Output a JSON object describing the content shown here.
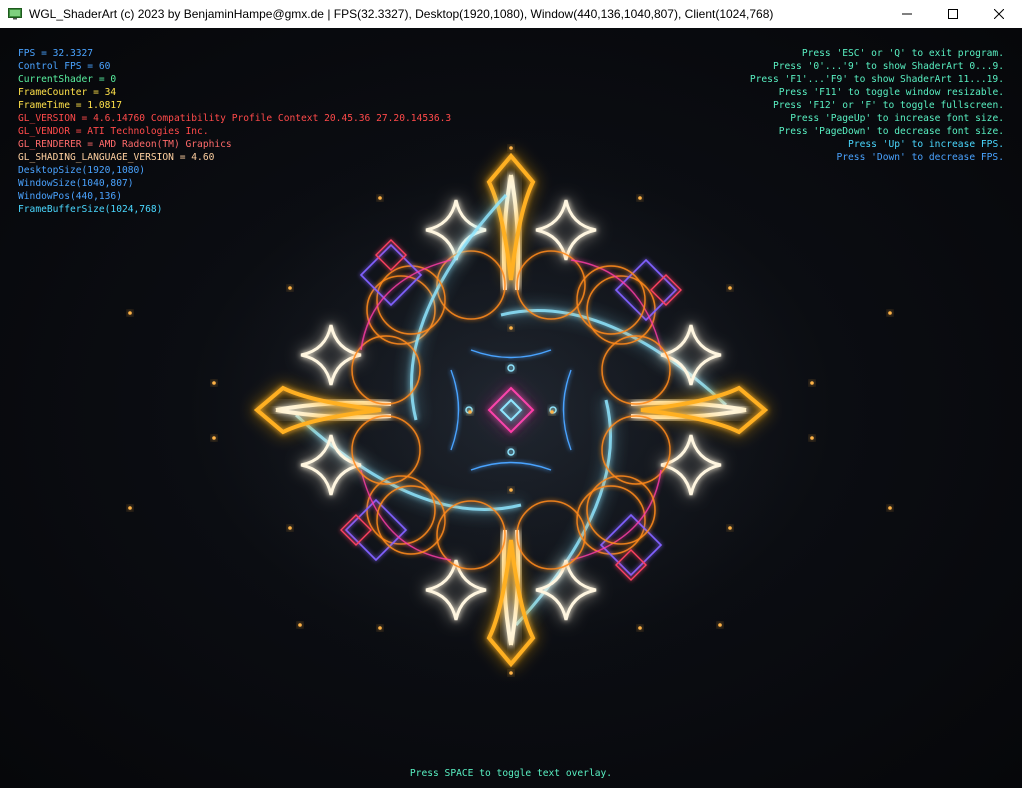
{
  "window": {
    "title": "WGL_ShaderArt (c) 2023 by BenjaminHampe@gmx.de | FPS(32.3327), Desktop(1920,1080), Window(440,136,1040,807), Client(1024,768)",
    "icon": "monitor-icon",
    "controls": {
      "minimize": "minimize-icon",
      "maximize": "maximize-icon",
      "close": "close-icon"
    }
  },
  "overlay_left": [
    {
      "text": "FPS = 32.3327",
      "color": "#4aa3ff"
    },
    {
      "text": "Control FPS = 60",
      "color": "#4aa3ff"
    },
    {
      "text": "CurrentShader = 0",
      "color": "#59f0a0"
    },
    {
      "text": "FrameCounter = 34",
      "color": "#ffe14a"
    },
    {
      "text": "FrameTime = 1.0817",
      "color": "#ffe14a"
    },
    {
      "text": "GL_VERSION = 4.6.14760 Compatibility Profile Context 20.45.36 27.20.14536.3",
      "color": "#ff4a4a"
    },
    {
      "text": "GL_VENDOR = ATI Technologies Inc.",
      "color": "#ff4a4a"
    },
    {
      "text": "GL_RENDERER = AMD Radeon(TM) Graphics",
      "color": "#ff6a6a"
    },
    {
      "text": "GL_SHADING_LANGUAGE_VERSION = 4.60",
      "color": "#ffd0a0"
    },
    {
      "text": "DesktopSize(1920,1080)",
      "color": "#4aa3ff"
    },
    {
      "text": "WindowSize(1040,807)",
      "color": "#4aa3ff"
    },
    {
      "text": "WindowPos(440,136)",
      "color": "#4aa3ff"
    },
    {
      "text": "FrameBufferSize(1024,768)",
      "color": "#4ad8ff"
    }
  ],
  "overlay_right": [
    {
      "text": "Press 'ESC' or 'Q' to exit program.",
      "color": "#59f0c2"
    },
    {
      "text": "Press '0'...'9' to show ShaderArt 0...9.",
      "color": "#59f0c2"
    },
    {
      "text": "Press 'F1'...'F9' to show ShaderArt 11...19.",
      "color": "#59f0c2"
    },
    {
      "text": "Press 'F11' to toggle window resizable.",
      "color": "#59f0c2"
    },
    {
      "text": "Press 'F12' or 'F' to toggle fullscreen.",
      "color": "#59f0c2"
    },
    {
      "text": "Press 'PageUp' to increase font size.",
      "color": "#59f0c2"
    },
    {
      "text": "Press 'PageDown' to decrease font size.",
      "color": "#59f0c2"
    },
    {
      "text": "Press 'Up' to increase FPS.",
      "color": "#4ad8ff"
    },
    {
      "text": "Press 'Down' to decrease FPS.",
      "color": "#4aa3ff"
    }
  ],
  "bottom_hint": "Press SPACE to toggle text overlay.",
  "colors": {
    "glow_gold": "#ffb020",
    "glow_white": "#fff6e0",
    "glow_cyan": "#8fe6ff",
    "glow_blue": "#4aa3ff",
    "glow_magenta": "#ff3ca8",
    "glow_violet": "#8060ff",
    "glow_orange": "#ff8a1a"
  }
}
